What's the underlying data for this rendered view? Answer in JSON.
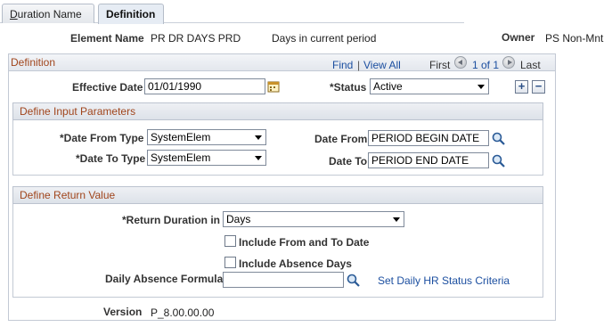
{
  "tabs": [
    {
      "label": "Duration Name",
      "accesskey": "D",
      "rest": "uration Name",
      "active": false
    },
    {
      "label": "Definition",
      "active": true
    }
  ],
  "header": {
    "element_name_label": "Element Name",
    "element_name_value": "PR DR DAYS PRD",
    "element_description": "Days in current period",
    "owner_label": "Owner",
    "owner_value": "PS Non-Mnt"
  },
  "definition": {
    "title": "Definition",
    "nav": {
      "find": "Find",
      "separator": "|",
      "view_all": "View All",
      "first": "First",
      "position": "1 of 1",
      "last": "Last"
    },
    "effective_date_label": "Effective Date",
    "effective_date_value": "01/01/1990",
    "status_label": "*Status",
    "status_value": "Active",
    "add_row": "+",
    "delete_row": "−"
  },
  "input_params": {
    "title": "Define Input Parameters",
    "date_from_type_label": "*Date From Type",
    "date_from_type_value": "SystemElem",
    "date_to_type_label": "*Date To Type",
    "date_to_type_value": "SystemElem",
    "date_from_label": "Date From",
    "date_from_value": "PERIOD BEGIN DATE",
    "date_to_label": "Date To",
    "date_to_value": "PERIOD END DATE"
  },
  "return_value": {
    "title": "Define Return Value",
    "return_duration_label": "*Return Duration in",
    "return_duration_value": "Days",
    "include_from_to_label": "Include From and To Date",
    "include_from_to_checked": false,
    "include_absence_label": "Include Absence Days",
    "include_absence_checked": false,
    "daily_absence_formula_label": "Daily Absence Formula",
    "daily_absence_formula_value": "",
    "status_criteria_link": "Set Daily HR Status Criteria"
  },
  "footer": {
    "version_label": "Version",
    "version_value": "P_8.00.00.00"
  },
  "colors": {
    "section_title": "#a0451c",
    "link": "#1c4fa0",
    "tab_active_bg": "#e6ecf4",
    "header_bg": "#e3e7ed"
  },
  "icons": [
    "calendar-icon",
    "lookup-icon",
    "previous-arrow-icon",
    "next-arrow-icon",
    "add-row-icon",
    "delete-row-icon"
  ]
}
